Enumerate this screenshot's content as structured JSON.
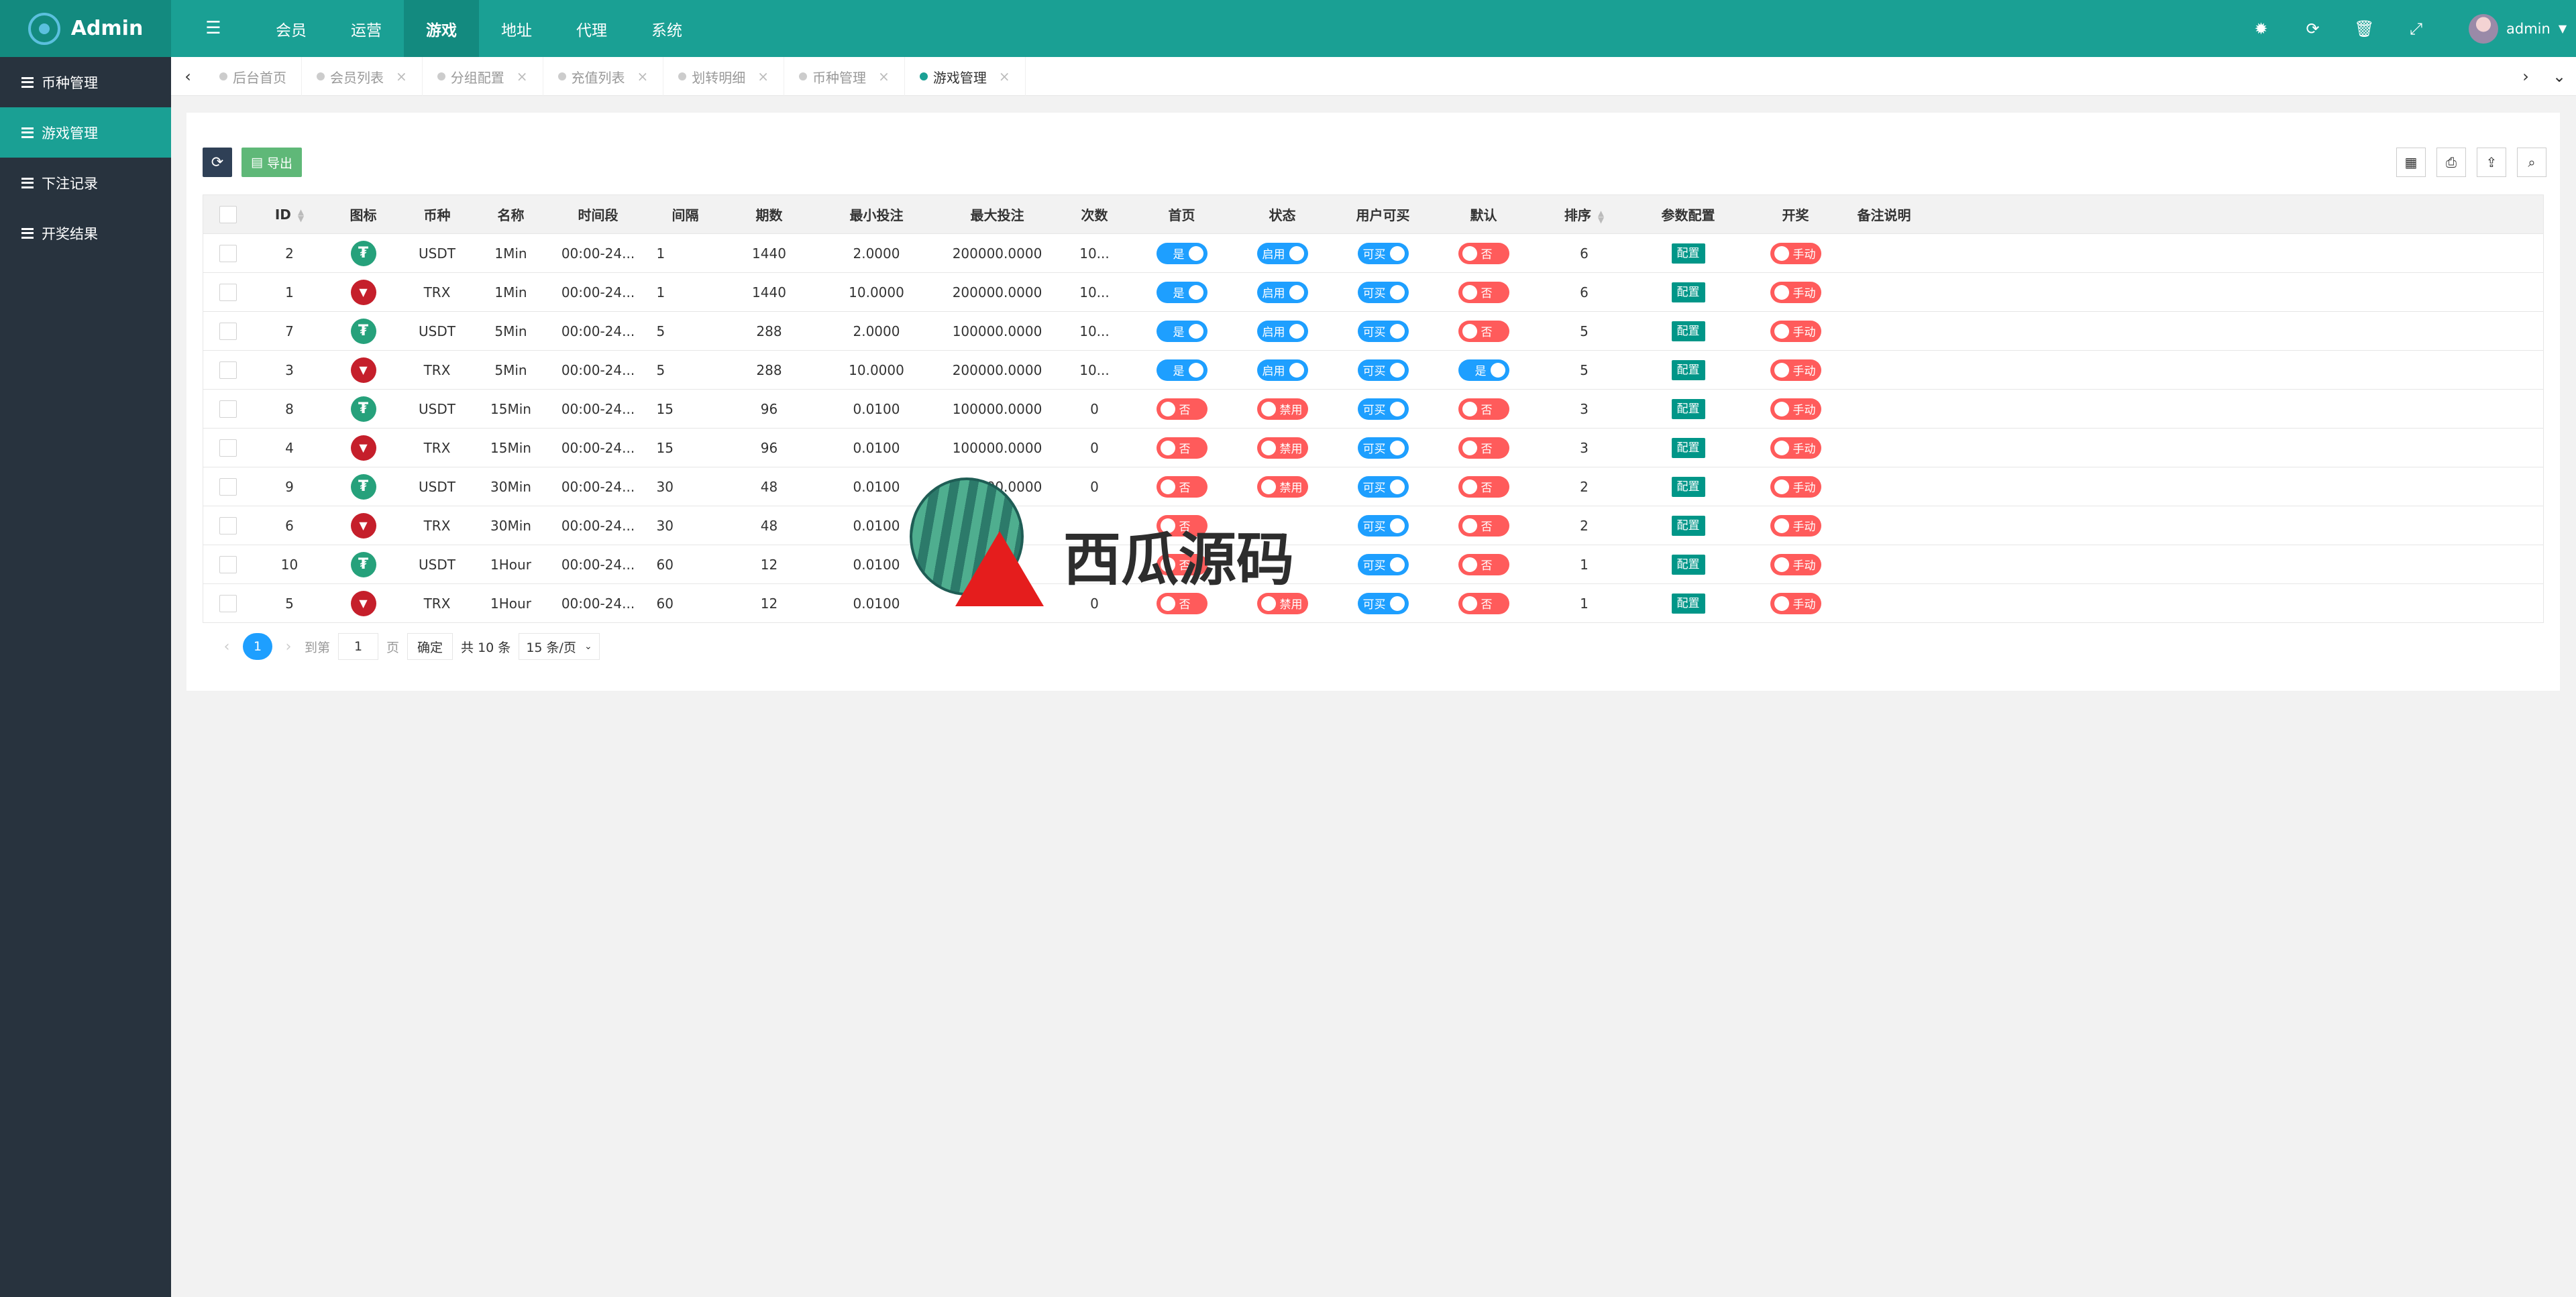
{
  "app": {
    "title": "Admin"
  },
  "top_nav": [
    {
      "label": "会员",
      "active": false
    },
    {
      "label": "运营",
      "active": false
    },
    {
      "label": "游戏",
      "active": true
    },
    {
      "label": "地址",
      "active": false
    },
    {
      "label": "代理",
      "active": false
    },
    {
      "label": "系统",
      "active": false
    }
  ],
  "top_icons": [
    "theme-icon",
    "refresh-icon",
    "trash-icon",
    "fullscreen-icon"
  ],
  "user": {
    "name": "admin"
  },
  "sidebar": [
    {
      "label": "币种管理",
      "active": false
    },
    {
      "label": "游戏管理",
      "active": true
    },
    {
      "label": "下注记录",
      "active": false
    },
    {
      "label": "开奖结果",
      "active": false
    }
  ],
  "tabs": [
    {
      "label": "后台首页",
      "active": false,
      "closable": false
    },
    {
      "label": "会员列表",
      "active": false,
      "closable": true
    },
    {
      "label": "分组配置",
      "active": false,
      "closable": true
    },
    {
      "label": "充值列表",
      "active": false,
      "closable": true
    },
    {
      "label": "划转明细",
      "active": false,
      "closable": true
    },
    {
      "label": "币种管理",
      "active": false,
      "closable": true
    },
    {
      "label": "游戏管理",
      "active": true,
      "closable": true
    }
  ],
  "toolbar": {
    "export_label": "导出"
  },
  "table": {
    "columns": [
      "ID",
      "图标",
      "币种",
      "名称",
      "时间段",
      "间隔",
      "期数",
      "最小投注",
      "最大投注",
      "次数",
      "首页",
      "状态",
      "用户可买",
      "默认",
      "排序",
      "参数配置",
      "开奖",
      "备注说明"
    ],
    "rows": [
      {
        "id": "2",
        "coin": "USDT",
        "name": "1Min",
        "time": "00:00-24...",
        "interval": "1",
        "periods": "1440",
        "min_bet": "2.0000",
        "max_bet": "200000.0000",
        "times": "10...",
        "home": "是",
        "status": "启用",
        "buy": "可买",
        "default": "否",
        "sort": "6",
        "config": "配置",
        "draw": "手动"
      },
      {
        "id": "1",
        "coin": "TRX",
        "name": "1Min",
        "time": "00:00-24...",
        "interval": "1",
        "periods": "1440",
        "min_bet": "10.0000",
        "max_bet": "200000.0000",
        "times": "10...",
        "home": "是",
        "status": "启用",
        "buy": "可买",
        "default": "否",
        "sort": "6",
        "config": "配置",
        "draw": "手动"
      },
      {
        "id": "7",
        "coin": "USDT",
        "name": "5Min",
        "time": "00:00-24...",
        "interval": "5",
        "periods": "288",
        "min_bet": "2.0000",
        "max_bet": "100000.0000",
        "times": "10...",
        "home": "是",
        "status": "启用",
        "buy": "可买",
        "default": "否",
        "sort": "5",
        "config": "配置",
        "draw": "手动"
      },
      {
        "id": "3",
        "coin": "TRX",
        "name": "5Min",
        "time": "00:00-24...",
        "interval": "5",
        "periods": "288",
        "min_bet": "10.0000",
        "max_bet": "200000.0000",
        "times": "10...",
        "home": "是",
        "status": "启用",
        "buy": "可买",
        "default": "是",
        "sort": "5",
        "config": "配置",
        "draw": "手动"
      },
      {
        "id": "8",
        "coin": "USDT",
        "name": "15Min",
        "time": "00:00-24...",
        "interval": "15",
        "periods": "96",
        "min_bet": "0.0100",
        "max_bet": "100000.0000",
        "times": "0",
        "home": "否",
        "status": "禁用",
        "buy": "可买",
        "default": "否",
        "sort": "3",
        "config": "配置",
        "draw": "手动"
      },
      {
        "id": "4",
        "coin": "TRX",
        "name": "15Min",
        "time": "00:00-24...",
        "interval": "15",
        "periods": "96",
        "min_bet": "0.0100",
        "max_bet": "100000.0000",
        "times": "0",
        "home": "否",
        "status": "禁用",
        "buy": "可买",
        "default": "否",
        "sort": "3",
        "config": "配置",
        "draw": "手动"
      },
      {
        "id": "9",
        "coin": "USDT",
        "name": "30Min",
        "time": "00:00-24...",
        "interval": "30",
        "periods": "48",
        "min_bet": "0.0100",
        "max_bet": "100000.0000",
        "times": "0",
        "home": "否",
        "status": "禁用",
        "buy": "可买",
        "default": "否",
        "sort": "2",
        "config": "配置",
        "draw": "手动"
      },
      {
        "id": "6",
        "coin": "TRX",
        "name": "30Min",
        "time": "00:00-24...",
        "interval": "30",
        "periods": "48",
        "min_bet": "0.0100",
        "max_bet": "",
        "times": "",
        "home": "否",
        "status": "",
        "buy": "可买",
        "default": "否",
        "sort": "2",
        "config": "配置",
        "draw": "手动"
      },
      {
        "id": "10",
        "coin": "USDT",
        "name": "1Hour",
        "time": "00:00-24...",
        "interval": "60",
        "periods": "12",
        "min_bet": "0.0100",
        "max_bet": "",
        "times": "",
        "home": "否",
        "status": "",
        "buy": "可买",
        "default": "否",
        "sort": "1",
        "config": "配置",
        "draw": "手动"
      },
      {
        "id": "5",
        "coin": "TRX",
        "name": "1Hour",
        "time": "00:00-24...",
        "interval": "60",
        "periods": "12",
        "min_bet": "0.0100",
        "max_bet": "",
        "times": "0",
        "home": "否",
        "status": "禁用",
        "buy": "可买",
        "default": "否",
        "sort": "1",
        "config": "配置",
        "draw": "手动"
      }
    ]
  },
  "pagination": {
    "current": "1",
    "goto_label": "到第",
    "goto_value": "1",
    "page_unit": "页",
    "confirm": "确定",
    "total": "共 10 条",
    "per_page": "15 条/页"
  },
  "watermark": {
    "text": "西瓜源码"
  },
  "colors": {
    "primary": "#1aa094",
    "sidebar": "#28333e",
    "switch_on": "#1e9fff",
    "switch_off": "#ff5b5b",
    "config_btn": "#009688"
  }
}
